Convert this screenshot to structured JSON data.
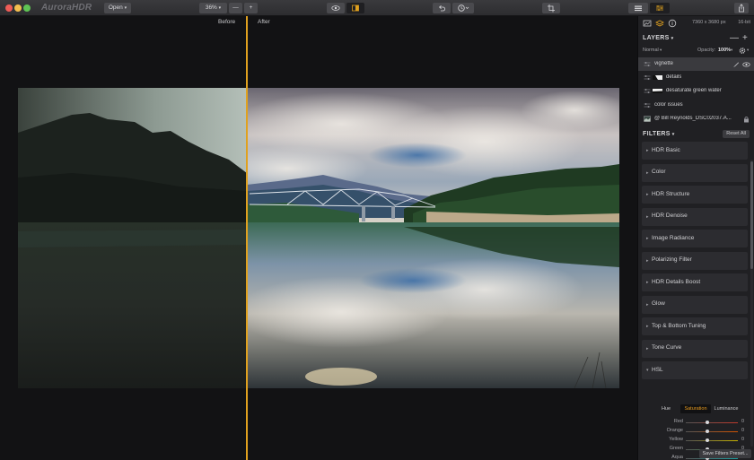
{
  "app": {
    "logo_text": "AuroraHDR",
    "open_label": "Open",
    "zoom_value": "36%",
    "zoom_minus": "—",
    "zoom_plus": "+"
  },
  "compare": {
    "before_label": "Before",
    "after_label": "After"
  },
  "panel": {
    "image_size": "7360 x 3680 px",
    "bit_depth": "16-bit",
    "layers_title": "LAYERS",
    "minus": "—",
    "plus": "+",
    "blend_mode": "Normal",
    "opacity_label": "Opacity:",
    "opacity_value": "100%",
    "layers": [
      {
        "name": "vignette",
        "active": true
      },
      {
        "name": "details",
        "active": false
      },
      {
        "name": "desaturate green water",
        "active": false
      },
      {
        "name": "color issues",
        "active": false
      },
      {
        "name": "@ Bill Reynolds_DSC02037.A...",
        "active": false
      }
    ],
    "filters_title": "FILTERS",
    "reset_all": "Reset All",
    "filters": [
      "HDR Basic",
      "Color",
      "HDR Structure",
      "HDR Denoise",
      "Image Radiance",
      "Polarizing Filter",
      "HDR Details Boost",
      "Glow",
      "Top & Bottom Tuning",
      "Tone Curve",
      "HSL"
    ],
    "hsl_tabs": [
      "Hue",
      "Saturation",
      "Luminance"
    ],
    "hsl_active_tab": "Saturation",
    "hsl_rows": [
      {
        "label": "Red",
        "value": "0",
        "color": "#c0392b"
      },
      {
        "label": "Orange",
        "value": "0",
        "color": "#d35400"
      },
      {
        "label": "Yellow",
        "value": "0",
        "color": "#c9b400"
      },
      {
        "label": "Green",
        "value": "0",
        "color": "#2f9e44"
      },
      {
        "label": "Aqua",
        "value": "0",
        "color": "#1a9fa0"
      }
    ],
    "save_preset": "Save Filters Preset..."
  },
  "colors": {
    "accent": "#e0a11f",
    "panel_bg": "#202023",
    "viewer_bg": "#121214"
  }
}
